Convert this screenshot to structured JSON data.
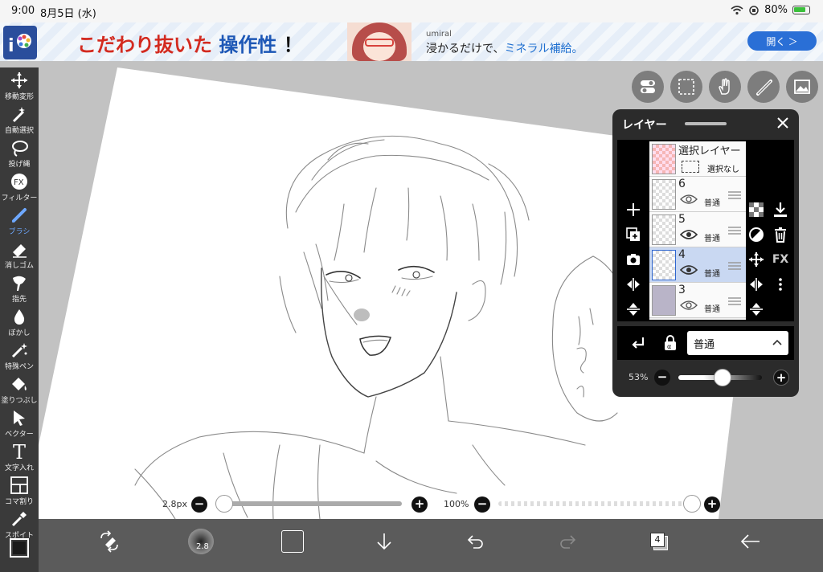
{
  "status_bar": {
    "time": "9:00",
    "date": "8月5日 (水)",
    "battery": "80%"
  },
  "ad": {
    "headline_part1": "こだわり抜いた",
    "headline_part2": "操作性",
    "headline_part3": "！",
    "brand": "umiral",
    "copy_part1": "浸かるだけで、",
    "copy_part2": "ミネラル補給。",
    "cta": "開く ＞"
  },
  "toolbar": {
    "tools": [
      {
        "label": "移動変形",
        "icon": "move-icon"
      },
      {
        "label": "自動選択",
        "icon": "magic-wand-icon"
      },
      {
        "label": "投げ縄",
        "icon": "lasso-icon"
      },
      {
        "label": "フィルター",
        "icon": "fx-icon"
      },
      {
        "label": "ブラシ",
        "icon": "brush-icon"
      },
      {
        "label": "消しゴム",
        "icon": "eraser-icon"
      },
      {
        "label": "指先",
        "icon": "finger-icon"
      },
      {
        "label": "ぼかし",
        "icon": "blur-icon"
      },
      {
        "label": "特殊ペン",
        "icon": "special-pen-icon"
      },
      {
        "label": "塗りつぶし",
        "icon": "fill-icon"
      },
      {
        "label": "ベクター",
        "icon": "vector-icon"
      },
      {
        "label": "文字入れ",
        "icon": "text-icon"
      },
      {
        "label": "コマ割り",
        "icon": "frame-divide-icon"
      },
      {
        "label": "スポイト",
        "icon": "eyedropper-icon"
      }
    ],
    "active": "ブラシ",
    "fx_glyph": "FX",
    "text_glyph": "T"
  },
  "layer_panel": {
    "title": "レイヤー",
    "selection_layer": {
      "name": "選択レイヤー",
      "status": "選択なし"
    },
    "layers": [
      {
        "name": "6",
        "mode": "普通",
        "selected": false
      },
      {
        "name": "5",
        "mode": "普通",
        "selected": false
      },
      {
        "name": "4",
        "mode": "普通",
        "selected": true
      },
      {
        "name": "3",
        "mode": "普通",
        "selected": false
      }
    ],
    "blend_mode": "普通",
    "opacity_label": "53%",
    "opacity_value": 0.53,
    "fx_label": "FX"
  },
  "brush_size": {
    "label": "2.8px",
    "value": 2.8
  },
  "brush_opacity": {
    "label": "100%",
    "value": 1.0
  },
  "bottom_bar": {
    "brush_badge": "2.8",
    "layer_count": "4"
  }
}
